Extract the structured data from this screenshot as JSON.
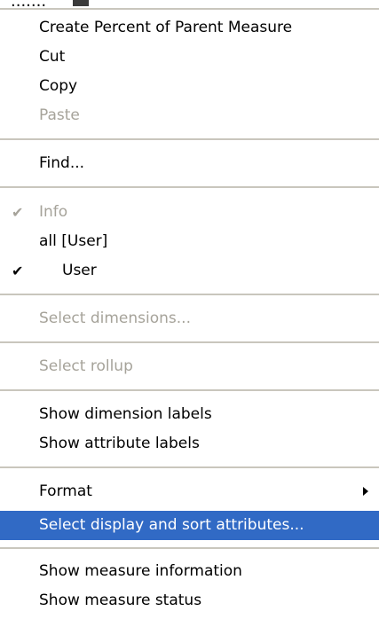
{
  "background_window": {
    "partial_text": "......."
  },
  "context_menu": {
    "items": [
      {
        "label": "Create Percent of Parent Measure"
      },
      {
        "label": "Cut"
      },
      {
        "label": "Copy"
      },
      {
        "label": "Paste",
        "disabled": true
      },
      {
        "label": "Find..."
      },
      {
        "label": "Info",
        "disabled": true,
        "checked": true
      },
      {
        "label": "all [User]"
      },
      {
        "label": "User",
        "checked": true
      },
      {
        "label": "Select dimensions...",
        "disabled": true
      },
      {
        "label": "Select rollup",
        "disabled": true
      },
      {
        "label": "Show dimension labels"
      },
      {
        "label": "Show attribute labels"
      },
      {
        "label": "Format",
        "submenu": true
      },
      {
        "label": "Select display and sort attributes...",
        "highlighted": true
      },
      {
        "label": "Show measure information"
      },
      {
        "label": "Show measure status"
      }
    ],
    "check_glyph": "✔",
    "colors": {
      "highlight": "#316ac5",
      "disabled_text": "#a6a39a",
      "separator": "#c9c6bd"
    }
  }
}
